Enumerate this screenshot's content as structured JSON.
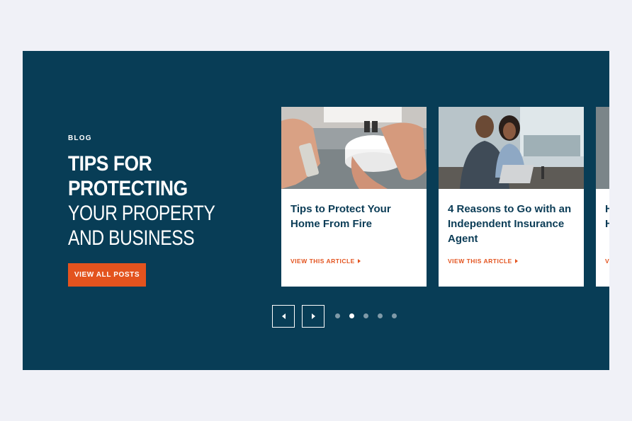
{
  "blog": {
    "eyebrow": "BLOG",
    "heading_bold_line1": "TIPS FOR",
    "heading_bold_line2": "PROTECTING",
    "heading_light_line1": "YOUR PROPERTY",
    "heading_light_line2": "AND BUSINESS",
    "view_all_label": "VIEW ALL POSTS"
  },
  "cards": [
    {
      "title": "Tips to Protect Your Home From Fire",
      "link_label": "VIEW THIS ARTICLE",
      "image": "smoke-detector-photo"
    },
    {
      "title": "4 Reasons to Go with an Independent Insurance Agent",
      "link_label": "VIEW THIS ARTICLE",
      "image": "people-laptop-photo"
    },
    {
      "title": "H H",
      "link_label": "V",
      "image": "partial-photo"
    }
  ],
  "carousel": {
    "prev_icon": "chevron-left-icon",
    "next_icon": "chevron-right-icon",
    "dot_count": 5,
    "active_index": 1
  },
  "colors": {
    "panel": "#083d56",
    "accent": "#e3531e",
    "card_title": "#0b3c56",
    "page_bg": "#f0f1f7"
  }
}
